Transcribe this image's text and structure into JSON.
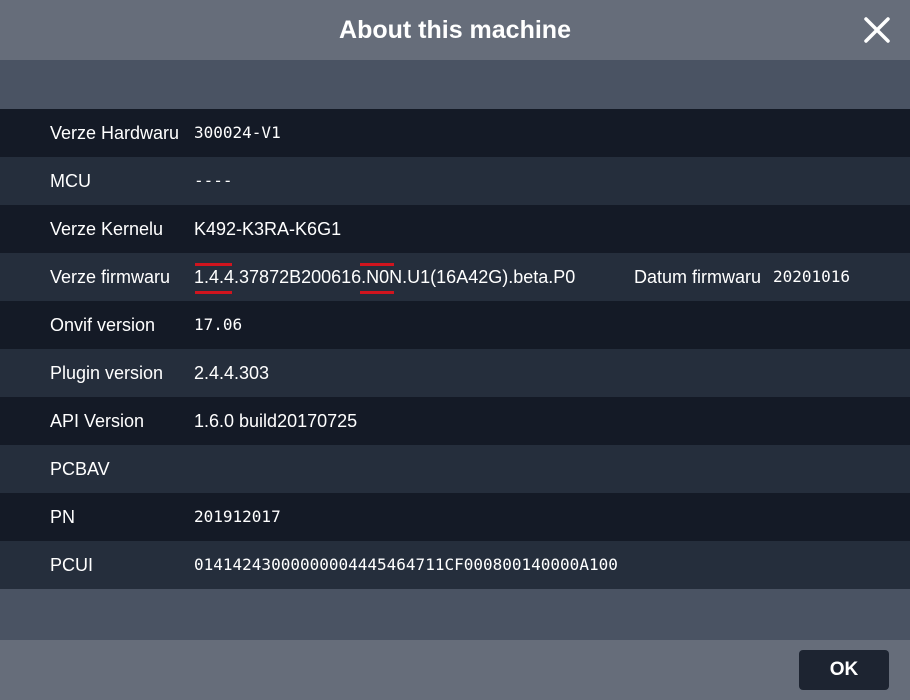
{
  "dialog": {
    "title": "About this machine",
    "ok_label": "OK"
  },
  "rows": [
    {
      "label": "Verze Hardwaru",
      "value": "300024-V1"
    },
    {
      "label": "MCU",
      "value": "----"
    },
    {
      "label": "Verze Kernelu",
      "value": "K492-K3RA-K6G1"
    },
    {
      "label": "Verze firmwaru",
      "value": "1.4.4.37872B200616.N0N.U1(16A42G).beta.P0",
      "extra_label": "Datum firmwaru",
      "extra_value": "20201016"
    },
    {
      "label": "Onvif version",
      "value": "17.06"
    },
    {
      "label": "Plugin version",
      "value": "2.4.4.303"
    },
    {
      "label": "API Version",
      "value": "1.6.0 build20170725"
    },
    {
      "label": "PCBAV",
      "value": ""
    },
    {
      "label": "PN",
      "value": "201912017"
    },
    {
      "label": "PCUI",
      "value": "01414243000000004445464711CF000800140000A100"
    }
  ],
  "colors": {
    "titlebar": "#666d7a",
    "body": "#4a5363",
    "row_dark": "#141a26",
    "row_light": "#252e3c",
    "highlight_mark": "#d0141e",
    "ok_button": "#1d2431"
  },
  "icons": {
    "close": "close-icon"
  }
}
